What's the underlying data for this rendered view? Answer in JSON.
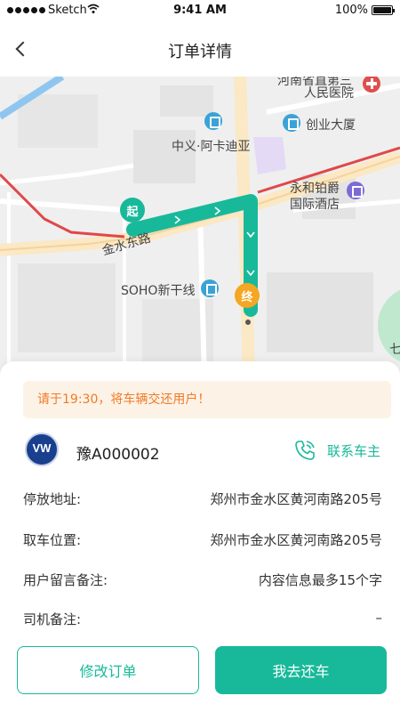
{
  "status_bar": {
    "carrier": "Sketch",
    "time": "9:41 AM",
    "battery": "100%"
  },
  "nav": {
    "title": "订单详情"
  },
  "map": {
    "pois": {
      "hospital": "人民医院",
      "hospital_top": "河南省直第三",
      "chuangye": "创业大厦",
      "zhongyi": "中义·阿卡迪亚",
      "yonghe_line1": "永和铂爵",
      "yonghe_line2": "国际酒店",
      "soho": "SOHO新干线",
      "road": "金水东路",
      "edge": "七"
    },
    "markers": {
      "start": "起",
      "end": "终"
    },
    "colors": {
      "route": "#18b99a",
      "main_road": "#e04848"
    }
  },
  "sheet": {
    "notice": "请于19:30，将车辆交还用户！",
    "car": {
      "plate": "豫A000002",
      "brand_logo": "volkswagen-logo"
    },
    "contact_label": "联系车主",
    "rows": [
      {
        "label": "停放地址:",
        "value": "郑州市金水区黄河南路205号"
      },
      {
        "label": "取车位置:",
        "value": "郑州市金水区黄河南路205号"
      },
      {
        "label": "用户留言备注:",
        "value": "内容信息最多15个字"
      },
      {
        "label": "司机备注:",
        "value": "–"
      }
    ],
    "buttons": {
      "modify": "修改订单",
      "return": "我去还车"
    },
    "accent": "#18b99a",
    "notice_color": "#ee7b28"
  }
}
